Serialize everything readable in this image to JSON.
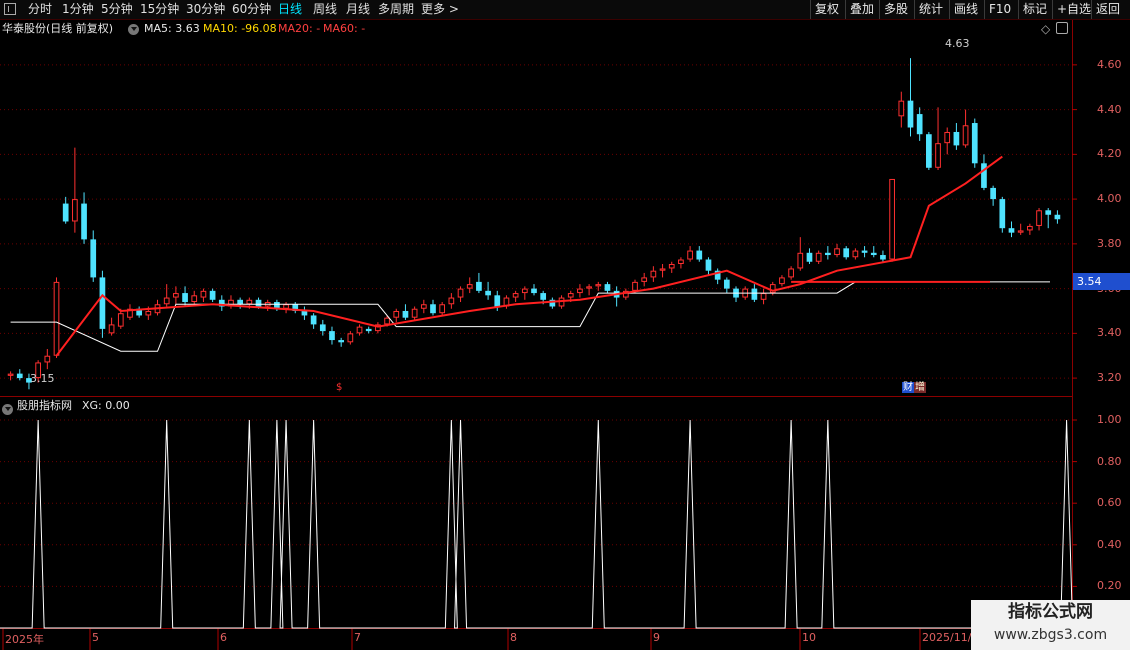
{
  "toolbar": {
    "tabs": [
      {
        "label": "分时"
      },
      {
        "label": "1分钟"
      },
      {
        "label": "5分钟"
      },
      {
        "label": "15分钟"
      },
      {
        "label": "30分钟"
      },
      {
        "label": "60分钟"
      },
      {
        "label": "日线",
        "active": true
      },
      {
        "label": "周线"
      },
      {
        "label": "月线"
      },
      {
        "label": "多周期"
      },
      {
        "label": "更多 >"
      }
    ],
    "right_buttons": [
      {
        "label": "复权"
      },
      {
        "label": "叠加"
      },
      {
        "label": "多股"
      },
      {
        "label": "统计"
      },
      {
        "label": "画线"
      },
      {
        "label": "F10"
      },
      {
        "label": "标记"
      },
      {
        "label": "+自选"
      },
      {
        "label": "返回"
      }
    ]
  },
  "main_header": {
    "title": "华泰股份(日线 前复权)",
    "ma5": "MA5: 3.63",
    "ma10": "MA10: -96.08",
    "ma20": "MA20: -",
    "ma60": "MA60: -"
  },
  "sub_header": {
    "title": "股朋指标网",
    "value": "XG: 0.00"
  },
  "price_axis": [
    "4.60",
    "4.40",
    "4.20",
    "4.00",
    "3.80",
    "3.60",
    "3.40",
    "3.20"
  ],
  "indicator_axis": [
    "1.00",
    "0.80",
    "0.60",
    "0.40",
    "0.20"
  ],
  "x_axis": [
    "2025年",
    "5",
    "6",
    "7",
    "8",
    "9",
    "10",
    "2025/11/"
  ],
  "annotations": {
    "high": "4.63",
    "low": "3.15",
    "current_price": "3.54",
    "finance_tag": "财",
    "finance_tag2": "增",
    "dollar_tag": "$"
  },
  "colors": {
    "up": "#ff3030",
    "down": "#4fe3ff",
    "grid": "#8b0000",
    "ma": "#ff2020"
  },
  "chart_data": {
    "type": "candlestick",
    "candles": [
      [
        3.21,
        3.23,
        3.19,
        3.22
      ],
      [
        3.22,
        3.24,
        3.19,
        3.2
      ],
      [
        3.2,
        3.22,
        3.15,
        3.18
      ],
      [
        3.2,
        3.28,
        3.18,
        3.27
      ],
      [
        3.27,
        3.33,
        3.24,
        3.3
      ],
      [
        3.3,
        3.65,
        3.29,
        3.63
      ],
      [
        3.98,
        4.01,
        3.89,
        3.9
      ],
      [
        3.9,
        4.23,
        3.85,
        4.0
      ],
      [
        3.98,
        4.03,
        3.8,
        3.82
      ],
      [
        3.82,
        3.86,
        3.63,
        3.65
      ],
      [
        3.65,
        3.68,
        3.38,
        3.42
      ],
      [
        3.4,
        3.47,
        3.39,
        3.44
      ],
      [
        3.43,
        3.51,
        3.42,
        3.49
      ],
      [
        3.47,
        3.53,
        3.46,
        3.51
      ],
      [
        3.51,
        3.52,
        3.47,
        3.48
      ],
      [
        3.48,
        3.52,
        3.46,
        3.5
      ],
      [
        3.49,
        3.55,
        3.48,
        3.53
      ],
      [
        3.53,
        3.62,
        3.52,
        3.56
      ],
      [
        3.56,
        3.61,
        3.53,
        3.58
      ],
      [
        3.58,
        3.61,
        3.52,
        3.54
      ],
      [
        3.54,
        3.59,
        3.52,
        3.57
      ],
      [
        3.56,
        3.6,
        3.54,
        3.59
      ],
      [
        3.59,
        3.6,
        3.54,
        3.55
      ],
      [
        3.55,
        3.57,
        3.5,
        3.52
      ],
      [
        3.52,
        3.57,
        3.51,
        3.55
      ],
      [
        3.55,
        3.56,
        3.51,
        3.53
      ],
      [
        3.53,
        3.56,
        3.51,
        3.55
      ],
      [
        3.55,
        3.56,
        3.51,
        3.52
      ],
      [
        3.52,
        3.55,
        3.5,
        3.54
      ],
      [
        3.54,
        3.55,
        3.5,
        3.51
      ],
      [
        3.51,
        3.54,
        3.49,
        3.53
      ],
      [
        3.53,
        3.54,
        3.49,
        3.5
      ],
      [
        3.5,
        3.52,
        3.46,
        3.48
      ],
      [
        3.48,
        3.49,
        3.42,
        3.44
      ],
      [
        3.44,
        3.46,
        3.39,
        3.41
      ],
      [
        3.41,
        3.43,
        3.35,
        3.37
      ],
      [
        3.37,
        3.38,
        3.34,
        3.36
      ],
      [
        3.36,
        3.41,
        3.35,
        3.4
      ],
      [
        3.4,
        3.44,
        3.39,
        3.43
      ],
      [
        3.42,
        3.43,
        3.4,
        3.41
      ],
      [
        3.41,
        3.45,
        3.4,
        3.44
      ],
      [
        3.44,
        3.48,
        3.43,
        3.47
      ],
      [
        3.47,
        3.51,
        3.45,
        3.5
      ],
      [
        3.5,
        3.53,
        3.46,
        3.47
      ],
      [
        3.47,
        3.52,
        3.46,
        3.51
      ],
      [
        3.51,
        3.55,
        3.49,
        3.53
      ],
      [
        3.53,
        3.55,
        3.48,
        3.49
      ],
      [
        3.49,
        3.54,
        3.48,
        3.53
      ],
      [
        3.53,
        3.58,
        3.51,
        3.56
      ],
      [
        3.56,
        3.61,
        3.54,
        3.6
      ],
      [
        3.6,
        3.65,
        3.58,
        3.62
      ],
      [
        3.63,
        3.67,
        3.58,
        3.59
      ],
      [
        3.59,
        3.63,
        3.55,
        3.57
      ],
      [
        3.57,
        3.59,
        3.5,
        3.52
      ],
      [
        3.52,
        3.57,
        3.51,
        3.56
      ],
      [
        3.56,
        3.59,
        3.54,
        3.58
      ],
      [
        3.58,
        3.61,
        3.55,
        3.6
      ],
      [
        3.6,
        3.62,
        3.57,
        3.58
      ],
      [
        3.58,
        3.59,
        3.53,
        3.55
      ],
      [
        3.55,
        3.56,
        3.51,
        3.52
      ],
      [
        3.52,
        3.57,
        3.51,
        3.56
      ],
      [
        3.56,
        3.59,
        3.54,
        3.58
      ],
      [
        3.58,
        3.62,
        3.56,
        3.6
      ],
      [
        3.6,
        3.62,
        3.57,
        3.61
      ],
      [
        3.61,
        3.63,
        3.59,
        3.62
      ],
      [
        3.62,
        3.63,
        3.58,
        3.59
      ],
      [
        3.59,
        3.61,
        3.52,
        3.56
      ],
      [
        3.56,
        3.6,
        3.55,
        3.59
      ],
      [
        3.59,
        3.64,
        3.58,
        3.63
      ],
      [
        3.63,
        3.67,
        3.61,
        3.65
      ],
      [
        3.65,
        3.7,
        3.63,
        3.68
      ],
      [
        3.68,
        3.71,
        3.65,
        3.69
      ],
      [
        3.69,
        3.72,
        3.67,
        3.71
      ],
      [
        3.71,
        3.74,
        3.69,
        3.73
      ],
      [
        3.73,
        3.79,
        3.72,
        3.77
      ],
      [
        3.77,
        3.79,
        3.72,
        3.73
      ],
      [
        3.73,
        3.74,
        3.66,
        3.68
      ],
      [
        3.68,
        3.69,
        3.62,
        3.64
      ],
      [
        3.64,
        3.65,
        3.58,
        3.6
      ],
      [
        3.6,
        3.61,
        3.54,
        3.56
      ],
      [
        3.56,
        3.61,
        3.55,
        3.6
      ],
      [
        3.6,
        3.62,
        3.54,
        3.55
      ],
      [
        3.55,
        3.6,
        3.53,
        3.58
      ],
      [
        3.58,
        3.63,
        3.57,
        3.62
      ],
      [
        3.62,
        3.66,
        3.61,
        3.65
      ],
      [
        3.65,
        3.7,
        3.64,
        3.69
      ],
      [
        3.69,
        3.83,
        3.68,
        3.76
      ],
      [
        3.76,
        3.78,
        3.71,
        3.72
      ],
      [
        3.72,
        3.77,
        3.71,
        3.76
      ],
      [
        3.76,
        3.79,
        3.73,
        3.75
      ],
      [
        3.75,
        3.8,
        3.74,
        3.78
      ],
      [
        3.78,
        3.79,
        3.73,
        3.74
      ],
      [
        3.74,
        3.78,
        3.73,
        3.77
      ],
      [
        3.77,
        3.79,
        3.74,
        3.76
      ],
      [
        3.76,
        3.79,
        3.74,
        3.75
      ],
      [
        3.75,
        3.77,
        3.72,
        3.73
      ],
      [
        3.73,
        4.09,
        3.72,
        4.09
      ],
      [
        4.37,
        4.48,
        4.32,
        4.44
      ],
      [
        4.44,
        4.63,
        4.28,
        4.32
      ],
      [
        4.38,
        4.41,
        4.26,
        4.29
      ],
      [
        4.29,
        4.3,
        4.13,
        4.14
      ],
      [
        4.14,
        4.41,
        4.13,
        4.25
      ],
      [
        4.25,
        4.32,
        4.2,
        4.3
      ],
      [
        4.3,
        4.34,
        4.22,
        4.24
      ],
      [
        4.24,
        4.4,
        4.23,
        4.33
      ],
      [
        4.34,
        4.36,
        4.14,
        4.16
      ],
      [
        4.16,
        4.2,
        4.04,
        4.05
      ],
      [
        4.05,
        4.06,
        3.97,
        4.0
      ],
      [
        4.0,
        4.01,
        3.85,
        3.87
      ],
      [
        3.87,
        3.9,
        3.83,
        3.85
      ],
      [
        3.85,
        3.89,
        3.84,
        3.86
      ],
      [
        3.86,
        3.89,
        3.84,
        3.88
      ],
      [
        3.88,
        3.96,
        3.86,
        3.95
      ],
      [
        3.95,
        3.96,
        3.87,
        3.93
      ],
      [
        3.93,
        3.95,
        3.89,
        3.91
      ]
    ],
    "ma_line": [
      [
        5,
        3.3
      ],
      [
        10,
        3.57
      ],
      [
        12,
        3.5
      ],
      [
        22,
        3.53
      ],
      [
        33,
        3.5
      ],
      [
        40,
        3.43
      ],
      [
        50,
        3.5
      ],
      [
        55,
        3.53
      ],
      [
        62,
        3.55
      ],
      [
        70,
        3.6
      ],
      [
        78,
        3.68
      ],
      [
        83,
        3.59
      ],
      [
        86,
        3.62
      ],
      [
        90,
        3.68
      ],
      [
        98,
        3.74
      ],
      [
        100,
        3.97
      ],
      [
        104,
        4.07
      ],
      [
        108,
        4.19
      ]
    ],
    "white_line": [
      [
        0,
        3.45
      ],
      [
        5,
        3.45
      ],
      [
        12,
        3.32
      ],
      [
        16,
        3.32
      ],
      [
        18,
        3.53
      ],
      [
        40,
        3.53
      ],
      [
        42,
        3.43
      ],
      [
        62,
        3.43
      ],
      [
        64,
        3.58
      ],
      [
        90,
        3.58
      ],
      [
        92,
        3.63
      ],
      [
        100,
        3.63
      ]
    ],
    "signals": [
      3,
      17,
      26,
      29,
      30,
      33,
      48,
      49,
      64,
      74,
      85,
      89,
      115
    ]
  }
}
